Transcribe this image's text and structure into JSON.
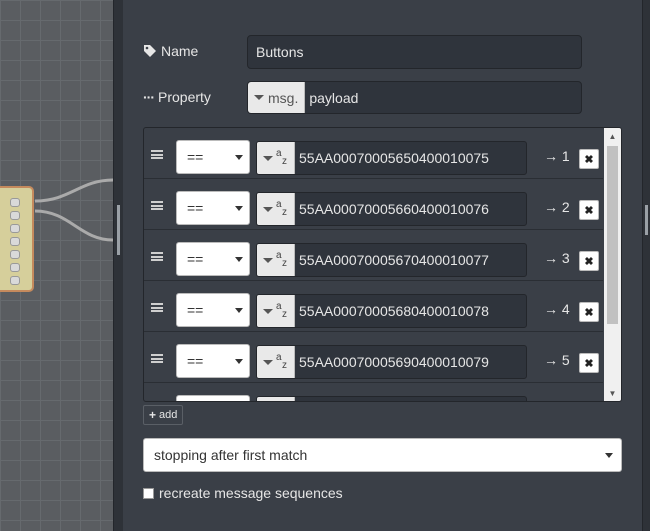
{
  "form": {
    "name_label": "Name",
    "name_value": "Buttons",
    "property_label": "Property",
    "property_type": "msg.",
    "property_value": "payload"
  },
  "rules": [
    {
      "operator": "==",
      "type_icon": "string-type-icon",
      "value": "55AA00070005650400010075",
      "output": "→ 1"
    },
    {
      "operator": "==",
      "type_icon": "string-type-icon",
      "value": "55AA00070005660400010076",
      "output": "→ 2"
    },
    {
      "operator": "==",
      "type_icon": "string-type-icon",
      "value": "55AA00070005670400010077",
      "output": "→ 3"
    },
    {
      "operator": "==",
      "type_icon": "string-type-icon",
      "value": "55AA00070005680400010078",
      "output": "→ 4"
    },
    {
      "operator": "==",
      "type_icon": "string-type-icon",
      "value": "55AA00070005690400010079",
      "output": "→ 5"
    },
    {
      "operator": "==",
      "type_icon": "string-type-icon",
      "value": "",
      "output": ""
    }
  ],
  "add_label": "add",
  "mode_value": "stopping after first match",
  "checkbox_label": "recreate message sequences",
  "colors": {
    "tray_bg": "#3a3f47",
    "input_bg": "#2f343c",
    "node_fill": "#d6cf9b",
    "node_border": "#c58a5d"
  }
}
